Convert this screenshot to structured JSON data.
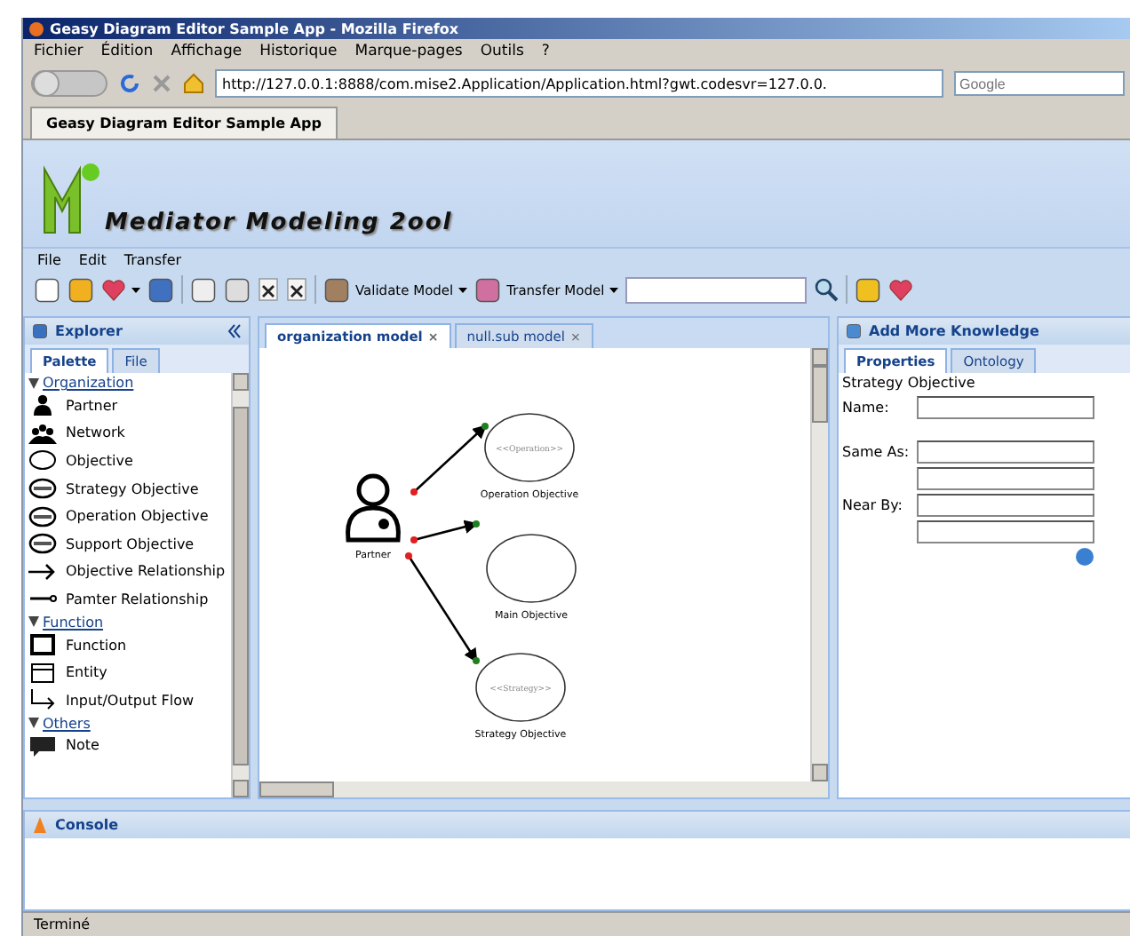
{
  "browser": {
    "title": "Geasy Diagram Editor Sample App - Mozilla Firefox",
    "menu": [
      "Fichier",
      "Édition",
      "Affichage",
      "Historique",
      "Marque-pages",
      "Outils",
      "?"
    ],
    "url": "http://127.0.0.1:8888/com.mise2.Application/Application.html?gwt.codesvr=127.0.0.",
    "search_placeholder": "Google",
    "tabs": [
      {
        "label": "Geasy Diagram Editor Sample App",
        "selected": true
      }
    ],
    "status": "Terminé"
  },
  "app": {
    "title": "Mediator Modeling 2ool",
    "menu": [
      "File",
      "Edit",
      "Transfer"
    ],
    "toolbar": [
      {
        "kind": "icon"
      },
      {
        "kind": "icon"
      },
      {
        "kind": "menu-icon"
      },
      {
        "kind": "icon"
      },
      {
        "kind": "separator"
      },
      {
        "kind": "icon"
      },
      {
        "kind": "icon"
      },
      {
        "kind": "icon"
      },
      {
        "kind": "icon"
      },
      {
        "kind": "separator"
      },
      {
        "kind": "menu",
        "label": "Validate Model"
      },
      {
        "kind": "menu",
        "label": "Transfer Model"
      },
      {
        "kind": "search"
      },
      {
        "kind": "separator"
      },
      {
        "kind": "icon"
      },
      {
        "kind": "icon"
      }
    ]
  },
  "explorer": {
    "title": "Explorer",
    "tabs": [
      {
        "label": "Palette",
        "selected": true
      },
      {
        "label": "File",
        "selected": false
      }
    ],
    "groups": [
      {
        "label": "Organization",
        "expanded": true,
        "children": [
          {
            "label": "Partner"
          },
          {
            "label": "Network"
          },
          {
            "label": "Objective"
          },
          {
            "label": "Strategy Objective"
          },
          {
            "label": "Operation Objective"
          },
          {
            "label": "Support Objective"
          },
          {
            "label": "Objective Relationship"
          },
          {
            "label": "Pamter Relationship"
          }
        ]
      },
      {
        "label": "Function",
        "expanded": true,
        "children": [
          {
            "label": "Function"
          },
          {
            "label": "Entity"
          },
          {
            "label": "Input/Output Flow"
          }
        ]
      },
      {
        "label": "Others",
        "expanded": true,
        "children": [
          {
            "label": "Note"
          }
        ]
      }
    ]
  },
  "editor": {
    "tabs": [
      {
        "label": "organization model",
        "close": "×",
        "selected": true
      },
      {
        "label": "null.sub model",
        "close": "×",
        "selected": false
      }
    ],
    "nodes": [
      {
        "kind": "actor",
        "label": "Partner"
      },
      {
        "kind": "objective",
        "label": "Operation Objective",
        "stereotype": "<<Operation>>"
      },
      {
        "kind": "objective",
        "label": "Main Objective"
      },
      {
        "kind": "objective",
        "label": "Strategy Objective",
        "stereotype": "<<Strategy>>"
      }
    ]
  },
  "knowledge": {
    "title": "Add More Knowledge",
    "tabs": [
      {
        "label": "Properties",
        "selected": true
      },
      {
        "label": "Ontology",
        "selected": false
      }
    ],
    "heading": "Strategy Objective",
    "fields": [
      {
        "label": "Name:"
      },
      {
        "label": "Same As:"
      },
      {
        "label": "Near By:"
      }
    ]
  },
  "console": {
    "title": "Console"
  }
}
